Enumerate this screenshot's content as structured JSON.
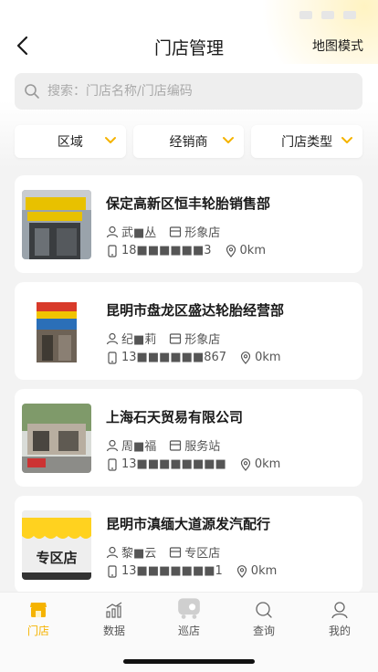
{
  "header": {
    "title": "门店管理",
    "map_mode": "地图模式"
  },
  "search": {
    "placeholder": "搜索：门店名称/门店编码"
  },
  "filters": [
    {
      "label": "区域"
    },
    {
      "label": "经销商"
    },
    {
      "label": "门店类型"
    }
  ],
  "stores": [
    {
      "name": "保定高新区恒丰轮胎销售部",
      "contact": "武■丛",
      "type": "形象店",
      "phone": "18■■■■■■3",
      "distance": "0km",
      "thumb": "shop-facade-yellow-sign"
    },
    {
      "name": "昆明市盘龙区盛达轮胎经营部",
      "contact": "纪■莉",
      "type": "形象店",
      "phone": "13■■■■■■867",
      "distance": "0km",
      "thumb": "shop-facade-red-sign"
    },
    {
      "name": "上海石天贸易有限公司",
      "contact": "周■福",
      "type": "服务站",
      "phone": "13■■■■■■■■",
      "distance": "0km",
      "thumb": "shop-street-view"
    },
    {
      "name": "昆明市滇缅大道源发汽配行",
      "contact": "黎■云",
      "type": "专区店",
      "phone": "13■■■■■■■1",
      "distance": "0km",
      "thumb": "zone-store-logo",
      "thumb_text": "专区店"
    }
  ],
  "tabbar": [
    {
      "label": "门店",
      "icon": "store-icon",
      "active": true
    },
    {
      "label": "数据",
      "icon": "chart-icon",
      "active": false
    },
    {
      "label": "巡店",
      "icon": "patrol-icon",
      "active": false
    },
    {
      "label": "查询",
      "icon": "search-icon",
      "active": false
    },
    {
      "label": "我的",
      "icon": "user-icon",
      "active": false
    }
  ],
  "colors": {
    "accent": "#f5b300",
    "background": "#f3f3f3"
  }
}
